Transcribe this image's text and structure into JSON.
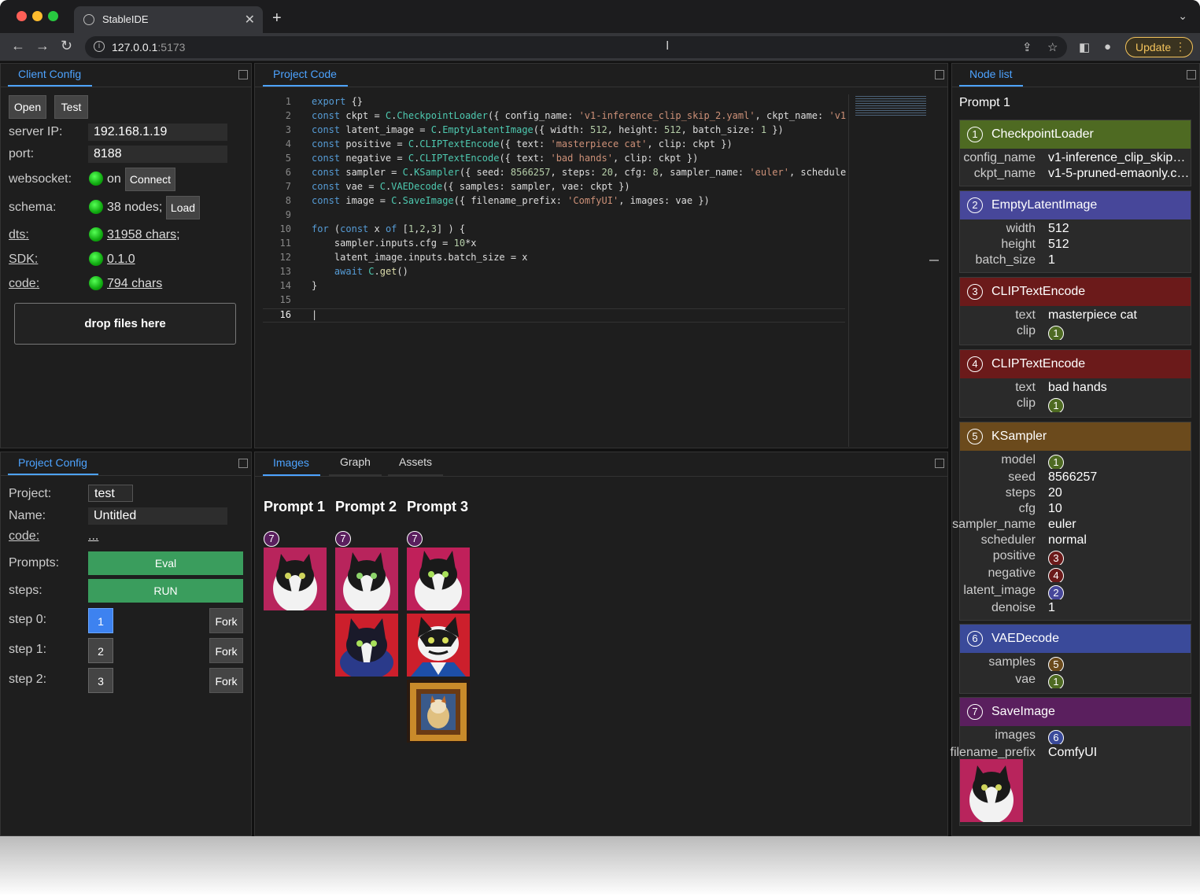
{
  "browser": {
    "tab_title": "StableIDE",
    "url_host": "127.0.0.1",
    "url_port": ":5173",
    "update_label": "Update"
  },
  "client": {
    "tab": "Client Config",
    "open": "Open",
    "test": "Test",
    "server_ip_label": "server IP:",
    "server_ip": "192.168.1.19",
    "port_label": "port:",
    "port": "8188",
    "ws_label": "websocket:",
    "ws_status": "on",
    "connect": "Connect",
    "schema_label": "schema:",
    "schema_status": "38 nodes;",
    "load": "Load",
    "dts_label": "dts:",
    "dts_value": "31958 chars;",
    "sdk_label": "SDK:",
    "sdk_value": "0.1.0",
    "code_label": "code:",
    "code_value": "794 chars",
    "drop": "drop files here"
  },
  "project": {
    "tab": "Project Config",
    "project_label": "Project:",
    "project_value": "test",
    "name_label": "Name:",
    "name_value": "Untitled",
    "code_label": "code:",
    "code_value": "...",
    "prompts_label": "Prompts:",
    "eval": "Eval",
    "steps_label": "steps:",
    "run": "RUN",
    "steps": [
      {
        "label": "step 0:",
        "num": "1"
      },
      {
        "label": "step 1:",
        "num": "2"
      },
      {
        "label": "step 2:",
        "num": "3"
      }
    ],
    "fork": "Fork"
  },
  "editor": {
    "tab": "Project Code"
  },
  "output": {
    "tabs": [
      "Images",
      "Graph",
      "Assets"
    ],
    "prompts": [
      "Prompt 1",
      "Prompt 2",
      "Prompt 3"
    ],
    "badge": "7"
  },
  "nodes": {
    "tab": "Node list",
    "prompt": "Prompt 1",
    "list": [
      {
        "n": "1",
        "title": "CheckpointLoader",
        "color": "#4e6a22",
        "rows": [
          [
            "config_name",
            "v1-inference_clip_skip_2..."
          ],
          [
            "ckpt_name",
            "v1-5-pruned-emaonly.ck..."
          ]
        ]
      },
      {
        "n": "2",
        "title": "EmptyLatentImage",
        "color": "#47479a",
        "rows": [
          [
            "width",
            "512"
          ],
          [
            "height",
            "512"
          ],
          [
            "batch_size",
            "1"
          ]
        ]
      },
      {
        "n": "3",
        "title": "CLIPTextEncode",
        "color": "#6b1a1a",
        "rows": [
          [
            "text",
            "masterpiece cat"
          ],
          [
            "clip",
            "@1"
          ]
        ]
      },
      {
        "n": "4",
        "title": "CLIPTextEncode",
        "color": "#6b1a1a",
        "rows": [
          [
            "text",
            "bad hands"
          ],
          [
            "clip",
            "@1"
          ]
        ]
      },
      {
        "n": "5",
        "title": "KSampler",
        "color": "#6b4a1c",
        "rows": [
          [
            "model",
            "@1"
          ],
          [
            "seed",
            "8566257"
          ],
          [
            "steps",
            "20"
          ],
          [
            "cfg",
            "10"
          ],
          [
            "sampler_name",
            "euler"
          ],
          [
            "scheduler",
            "normal"
          ],
          [
            "positive",
            "@3"
          ],
          [
            "negative",
            "@4"
          ],
          [
            "latent_image",
            "@2"
          ],
          [
            "denoise",
            "1"
          ]
        ]
      },
      {
        "n": "6",
        "title": "VAEDecode",
        "color": "#3a4a9a",
        "rows": [
          [
            "samples",
            "@5"
          ],
          [
            "vae",
            "@1"
          ]
        ]
      },
      {
        "n": "7",
        "title": "SaveImage",
        "color": "#5a1f5e",
        "rows": [
          [
            "images",
            "@6"
          ],
          [
            "filename_prefix",
            "ComfyUI"
          ]
        ]
      }
    ]
  },
  "badge_colors": {
    "1": "#4e6a22",
    "2": "#47479a",
    "3": "#6b1a1a",
    "4": "#6b1a1a",
    "5": "#6b4a1c",
    "6": "#3a4a9a",
    "7": "#5a1f5e"
  }
}
